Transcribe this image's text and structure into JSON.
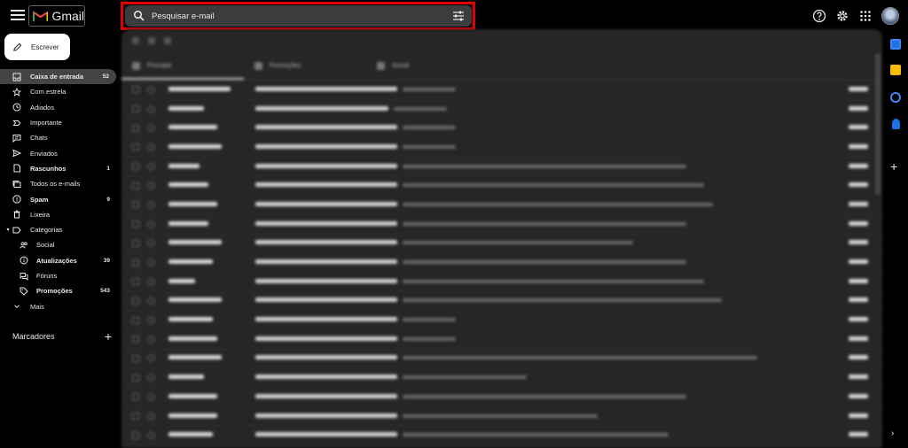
{
  "app": {
    "name": "Gmail"
  },
  "search": {
    "placeholder": "Pesquisar e-mail"
  },
  "compose": {
    "label": "Escrever"
  },
  "nav": [
    {
      "label": "Caixa de entrada",
      "count": "52",
      "icon": "inbox-icon"
    },
    {
      "label": "Com estrela",
      "count": "",
      "icon": "star-icon"
    },
    {
      "label": "Adiados",
      "count": "",
      "icon": "clock-icon"
    },
    {
      "label": "Importante",
      "count": "",
      "icon": "important-icon"
    },
    {
      "label": "Chats",
      "count": "",
      "icon": "chat-icon"
    },
    {
      "label": "Enviados",
      "count": "",
      "icon": "send-icon"
    },
    {
      "label": "Rascunhos",
      "count": "1",
      "icon": "draft-icon"
    },
    {
      "label": "Todos os e-mails",
      "count": "",
      "icon": "all-mail-icon"
    },
    {
      "label": "Spam",
      "count": "9",
      "icon": "spam-icon"
    },
    {
      "label": "Lixeira",
      "count": "",
      "icon": "trash-icon"
    },
    {
      "label": "Categorias",
      "count": "",
      "icon": "label-icon"
    },
    {
      "label": "Social",
      "count": "",
      "icon": "people-icon"
    },
    {
      "label": "Atualizações",
      "count": "39",
      "icon": "info-icon"
    },
    {
      "label": "Fóruns",
      "count": "",
      "icon": "forum-icon"
    },
    {
      "label": "Promoções",
      "count": "543",
      "icon": "tag-icon"
    },
    {
      "label": "Mais",
      "count": "",
      "icon": "chevron-down-icon"
    }
  ],
  "labels_section": {
    "title": "Marcadores"
  },
  "colors": {
    "search_highlight": "#e00000",
    "background": "#000000",
    "panel": "#262626"
  },
  "tabs": [
    {
      "label": "Principal"
    },
    {
      "label": "Promoções"
    },
    {
      "label": "Social"
    }
  ]
}
